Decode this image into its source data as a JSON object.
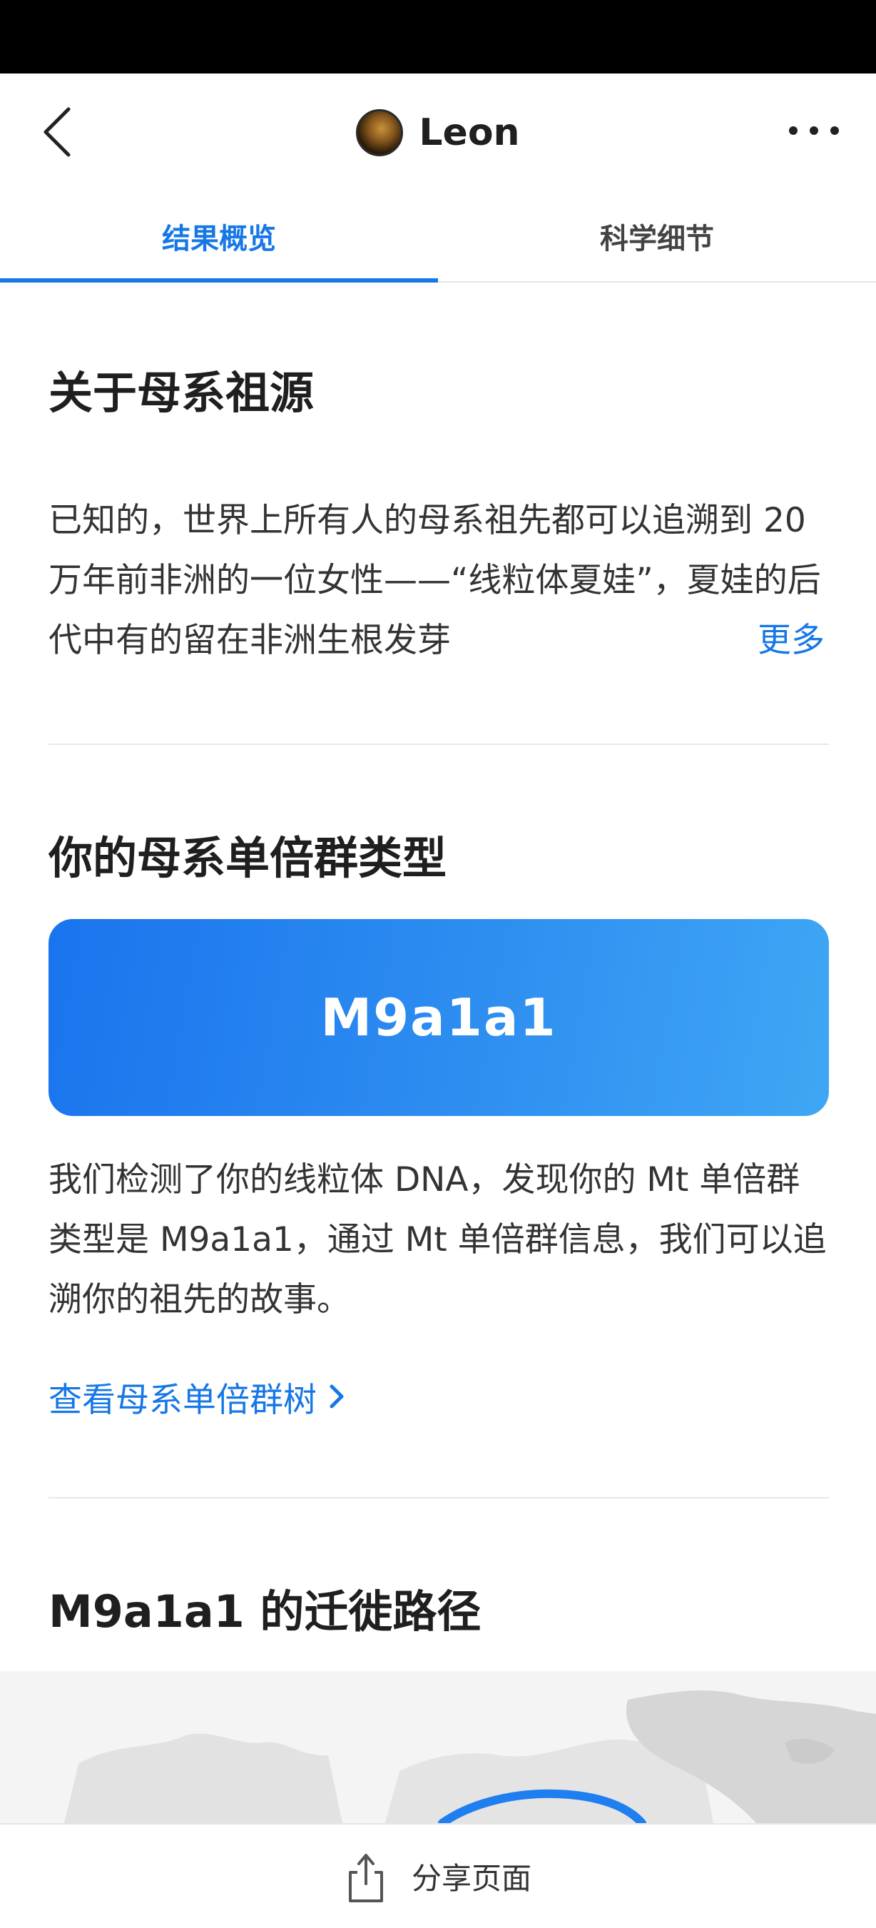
{
  "header": {
    "title": "Leon"
  },
  "tabs": [
    {
      "label": "结果概览",
      "active": true
    },
    {
      "label": "科学细节",
      "active": false
    }
  ],
  "maternal_origin": {
    "title": "关于母系祖源",
    "intro": "已知的，世界上所有人的母系祖先都可以追溯到 20 万年前非洲的一位女性——“线粒体夏娃”，夏娃的后代中有的留在非洲生根发芽",
    "more_label": "更多"
  },
  "haplogroup": {
    "title": "你的母系单倍群类型",
    "value": "M9a1a1",
    "description": "我们检测了你的线粒体 DNA，发现你的 Mt 单倍群类型是 M9a1a1，通过 Mt 单倍群信息，我们可以追溯你的祖先的故事。",
    "tree_link_label": "查看母系单倍群树"
  },
  "migration": {
    "title": "M9a1a1 的迁徙路径"
  },
  "bottom_bar": {
    "share_label": "分享页面"
  },
  "colors": {
    "accent": "#1677e6",
    "card_gradient_start": "#1a74ee",
    "card_gradient_end": "#3fa7f5"
  }
}
